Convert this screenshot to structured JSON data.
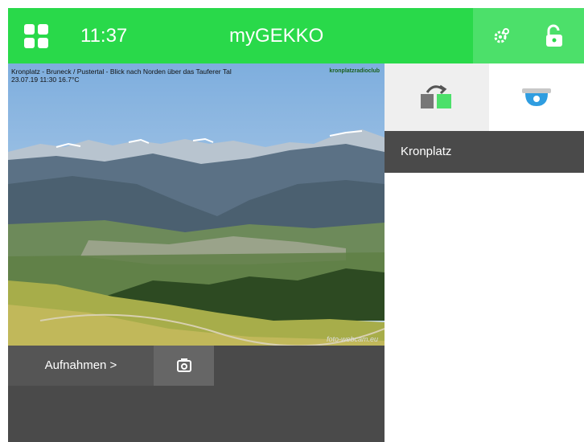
{
  "header": {
    "time": "11:37",
    "title": "myGEKKO",
    "accent_color": "#29d94a",
    "icons": [
      "grid-icon",
      "settings-gear-icon",
      "unlock-icon"
    ]
  },
  "camera": {
    "caption_line1": "Kronplatz - Bruneck / Pustertal - Blick nach Norden über das Tauferer Tal",
    "caption_line2": "23.07.19 11:30   16.7°C",
    "logo_text": "kronplatzradioclub",
    "watermark": "foto-webcam.eu",
    "recordings_label": "Aufnahmen >"
  },
  "side_panel": {
    "camera_name": "Kronplatz",
    "icons": [
      "switch-view-icon",
      "dome-camera-icon"
    ]
  }
}
